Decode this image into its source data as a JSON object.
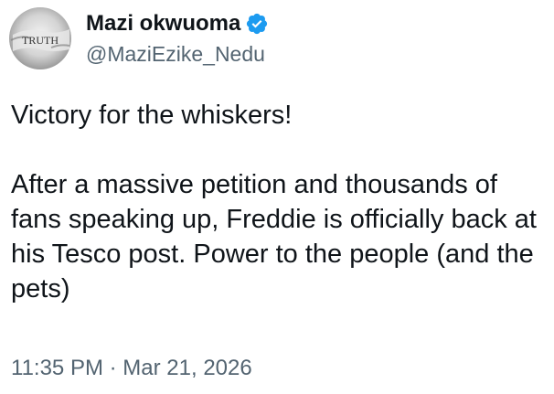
{
  "author": {
    "display_name": "Mazi okwuoma",
    "handle": "@MaziEzike_Nedu",
    "verified": true,
    "verified_color": "#1d9bf0",
    "avatar_text": "TRUTH",
    "avatar_icon": "truth-text-avatar"
  },
  "tweet": {
    "text_line1": "Victory for the whiskers!",
    "text_paragraph2": "After a massive petition and thousands of fans speaking up, Freddie is officially back at his Tesco post. Power to the people (and the pets)",
    "time": "11:35 PM",
    "separator": "·",
    "date": "Mar 21, 2026"
  },
  "colors": {
    "text": "#0f1419",
    "secondary": "#536471",
    "background": "#ffffff"
  }
}
